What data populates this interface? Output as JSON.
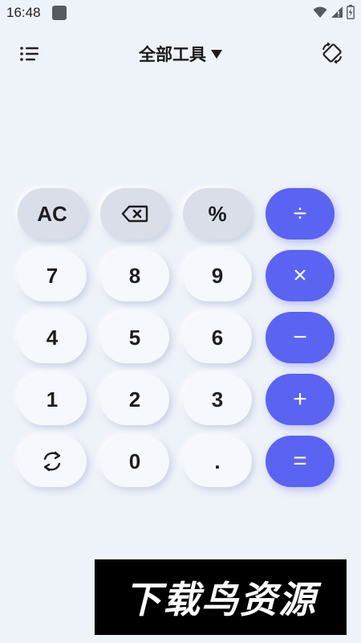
{
  "status_bar": {
    "time": "16:48"
  },
  "app_bar": {
    "title": "全部工具",
    "menu_icon": "menu-icon",
    "rotate_icon": "screen-rotate-icon"
  },
  "keypad": {
    "row1": [
      "AC",
      "backspace",
      "%",
      "÷"
    ],
    "row2": [
      "7",
      "8",
      "9",
      "×"
    ],
    "row3": [
      "4",
      "5",
      "6",
      "−"
    ],
    "row4": [
      "1",
      "2",
      "3",
      "+"
    ],
    "row5": [
      "refresh",
      "0",
      ".",
      "="
    ],
    "labels": {
      "ac": "AC",
      "percent": "%",
      "divide": "÷",
      "seven": "7",
      "eight": "8",
      "nine": "9",
      "multiply": "×",
      "four": "4",
      "five": "5",
      "six": "6",
      "minus": "−",
      "one": "1",
      "two": "2",
      "three": "3",
      "plus": "+",
      "zero": "0",
      "dot": ".",
      "equals": "="
    }
  },
  "watermark": {
    "text": "下载鸟资源"
  },
  "colors": {
    "background": "#eef2f9",
    "operator_key": "#5b63f3",
    "function_key": "#d9dee8",
    "number_key": "#f5f8fd",
    "text": "#1d1d1f"
  }
}
